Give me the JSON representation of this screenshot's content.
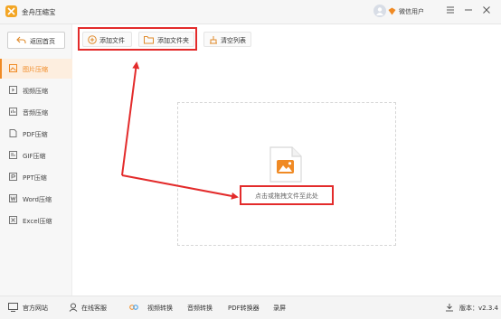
{
  "app": {
    "title": "金舟压缩宝"
  },
  "user": {
    "name": "微信用户"
  },
  "sidebar": {
    "back_label": "返回首页",
    "items": [
      {
        "label": "图片压缩",
        "active": true
      },
      {
        "label": "视频压缩"
      },
      {
        "label": "音频压缩"
      },
      {
        "label": "PDF压缩"
      },
      {
        "label": "GIF压缩"
      },
      {
        "label": "PPT压缩"
      },
      {
        "label": "Word压缩"
      },
      {
        "label": "Excel压缩"
      }
    ]
  },
  "toolbar": {
    "add_file_label": "添加文件",
    "add_folder_label": "添加文件夹",
    "clear_list_label": "清空列表"
  },
  "dropzone": {
    "hint": "点击或拖拽文件至此处"
  },
  "bottom": {
    "website": "官方网站",
    "support": "在线客服",
    "video_convert": "视频转换",
    "audio_convert": "音频转换",
    "pdf_convert": "PDF转换器",
    "record": "录屏",
    "version_label": "版本：v2.3.4"
  },
  "colors": {
    "accent": "#f08a24",
    "highlight": "#e32b2b"
  }
}
